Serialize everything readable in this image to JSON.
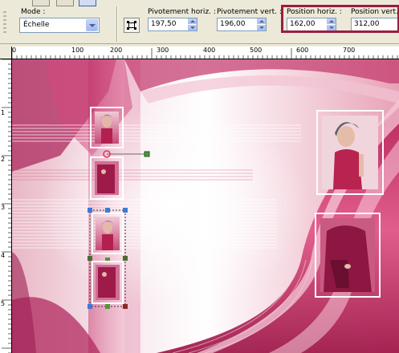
{
  "toolbar": {
    "mode_label": "Mode :",
    "mode_value": "Échelle",
    "pivot_h_label": "Pivotement horiz. :",
    "pivot_h_value": "197,50",
    "pivot_v_label": "Pivotement vert. :",
    "pivot_v_value": "196,00",
    "pos_h_label": "Position horiz. :",
    "pos_h_value": "162,00",
    "pos_v_label": "Position vert. :",
    "pos_v_value": "312,00",
    "highlight_color": "#9b1d41"
  },
  "ruler_h": [
    "0",
    "100",
    "200",
    "300",
    "400",
    "500",
    "600",
    "700"
  ],
  "ruler_v": [
    "1",
    "2",
    "3",
    "4",
    "5"
  ],
  "canvas": {
    "accent_color": "#c8306a",
    "handle_color": "#3c7ad6",
    "pivot_color": "#e0305a"
  }
}
